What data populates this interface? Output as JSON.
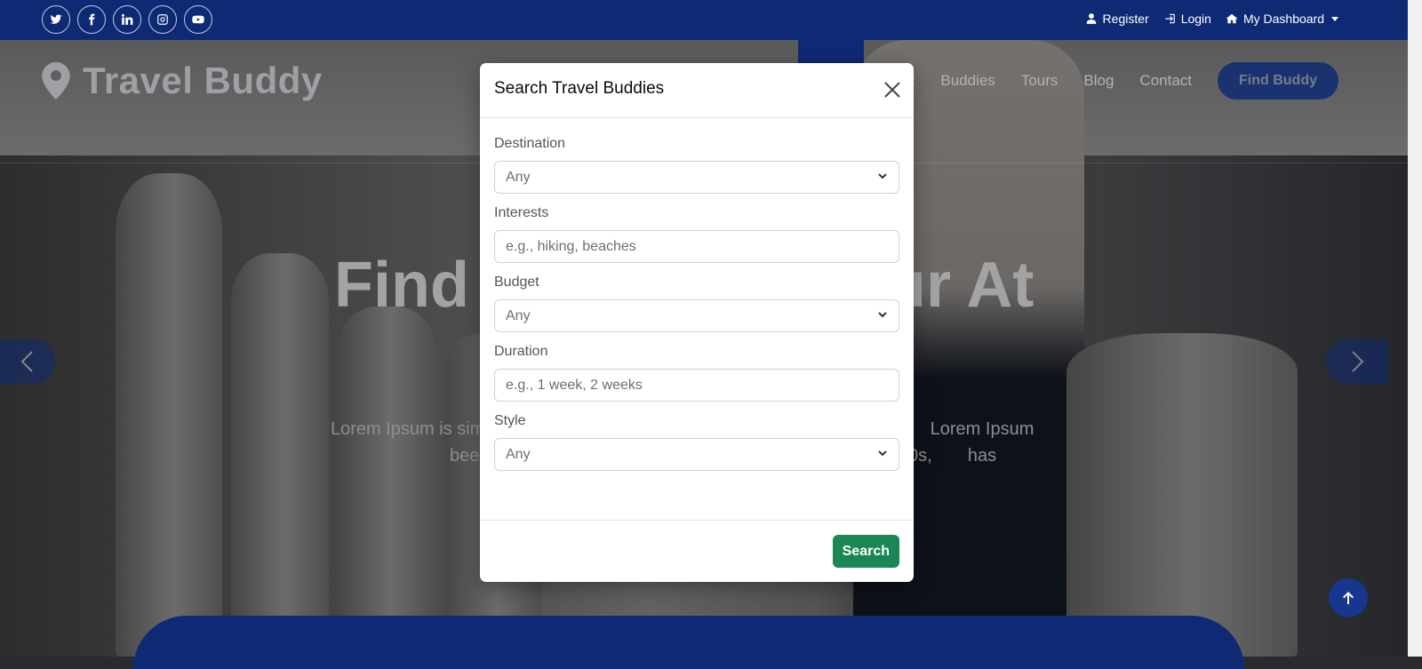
{
  "topbar": {
    "socials": [
      {
        "icon": "twitter-icon",
        "label": "t"
      },
      {
        "icon": "facebook-icon",
        "label": "f"
      },
      {
        "icon": "linkedin-icon",
        "label": "in"
      },
      {
        "icon": "instagram-icon",
        "label": "ig"
      },
      {
        "icon": "youtube-icon",
        "label": "yt"
      }
    ],
    "register_label": "Register",
    "login_label": "Login",
    "dashboard_label": "My Dashboard"
  },
  "header": {
    "logo_text": "Travel Buddy",
    "nav": {
      "partial_label": "t",
      "buddies_label": "Buddies",
      "tours_label": "Tours",
      "blog_label": "Blog",
      "contact_label": "Contact"
    },
    "find_buddy_label": "Find Buddy"
  },
  "hero": {
    "title_left": "Find Y",
    "title_right": "ur At",
    "text_line1_left": "Lorem Ipsum is sim",
    "text_line1_right": "Lorem Ipsum has",
    "text_line2_left": "bee",
    "text_line2_right": "0s,"
  },
  "modal": {
    "title": "Search Travel Buddies",
    "fields": {
      "destination": {
        "label": "Destination",
        "value": "Any"
      },
      "interests": {
        "label": "Interests",
        "placeholder": "e.g., hiking, beaches"
      },
      "budget": {
        "label": "Budget",
        "value": "Any"
      },
      "duration": {
        "label": "Duration",
        "placeholder": "e.g., 1 week, 2 weeks"
      },
      "style": {
        "label": "Style",
        "value": "Any"
      }
    },
    "search_label": "Search"
  },
  "colors": {
    "brand_navy": "#0f2a74",
    "search_green": "#1a8754"
  }
}
